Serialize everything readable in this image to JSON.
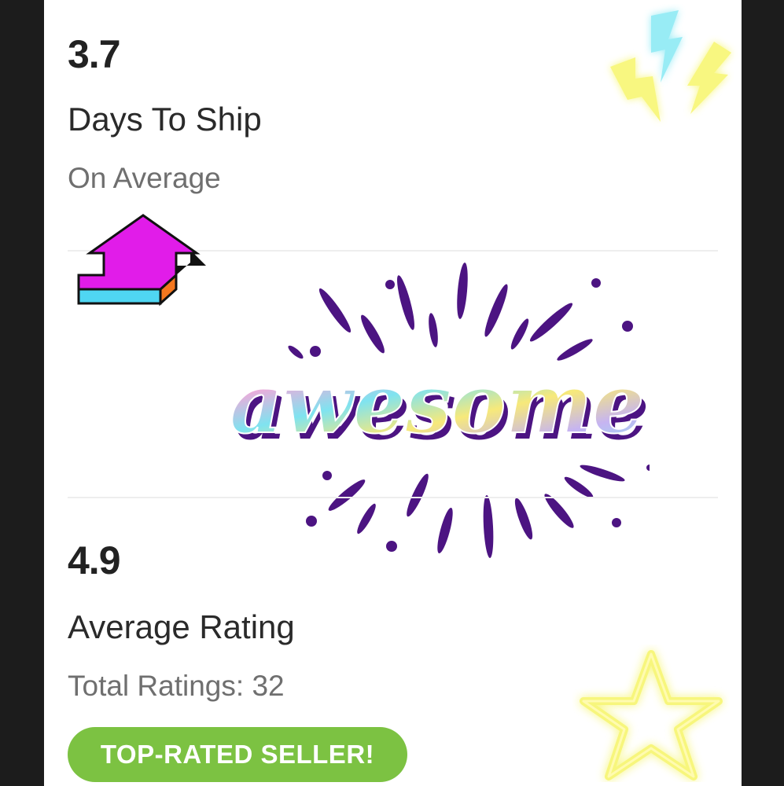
{
  "shipping": {
    "value": "3.7",
    "label": "Days To Ship",
    "sublabel": "On Average"
  },
  "rating": {
    "value": "4.9",
    "label": "Average Rating",
    "sublabel": "Total Ratings: 32"
  },
  "badge": {
    "label": "TOP-RATED SELLER!"
  },
  "stickers": {
    "awesome_text": "awesome",
    "arrow_icon": "arrow-up-sticker-icon",
    "lightning_icon": "neon-lightning-sticker-icon",
    "star_icon": "neon-star-sticker-icon",
    "burst_icon": "burst-rays-icon"
  },
  "colors": {
    "badge_green": "#7cc242",
    "arrow_magenta": "#e11ce9",
    "arrow_cyan": "#4fd6f2",
    "arrow_orange": "#f5771e",
    "burst_purple": "#4c1482",
    "neon_yellow": "#f6f566",
    "neon_cyan": "#62e0f4"
  }
}
